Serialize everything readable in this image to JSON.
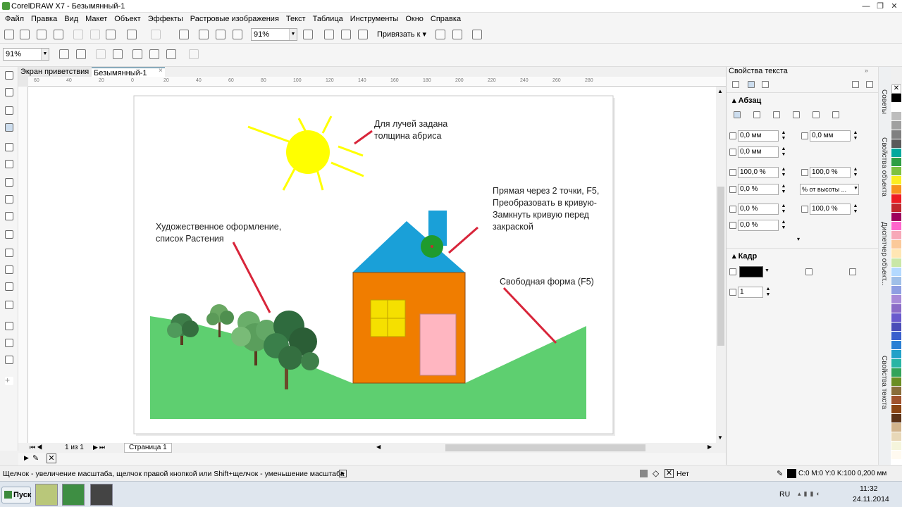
{
  "window": {
    "title": "CorelDRAW X7 - Безымянный-1"
  },
  "menu": [
    "Файл",
    "Правка",
    "Вид",
    "Макет",
    "Объект",
    "Эффекты",
    "Растровые изображения",
    "Текст",
    "Таблица",
    "Инструменты",
    "Окно",
    "Справка"
  ],
  "toolbar": {
    "zoom_value": "91%",
    "snap_label": "Привязать к"
  },
  "propbar": {
    "zoom_value": "91%"
  },
  "tabs": [
    {
      "label": "Экран приветствия"
    },
    {
      "label": "Безымянный-1"
    }
  ],
  "ruler_labels": [
    "60",
    "40",
    "20",
    "0",
    "20",
    "40",
    "60",
    "80",
    "100",
    "120",
    "140",
    "160",
    "180",
    "200",
    "220",
    "240",
    "260",
    "280"
  ],
  "canvas_notes": {
    "note1": [
      "Для лучей задана",
      "толщина абриса"
    ],
    "note2": [
      "Прямая через 2 точки, F5,",
      "Преобразовать в кривую-",
      "Замкнуть кривую перед",
      "закраской"
    ],
    "note3": [
      "Художественное оформление,",
      "список Растения"
    ],
    "note4": [
      "Свободная форма (F5)"
    ]
  },
  "pages": {
    "counter": "1 из 1",
    "page_tab": "Страница 1"
  },
  "dock": {
    "title": "Свойства текста",
    "paragraph_section": "Абзац",
    "fields": {
      "indent_left": "0,0 мм",
      "indent_first": "0,0 мм",
      "indent_right": "0,0 мм",
      "spacing_char": "100,0 %",
      "spacing_line": "100,0 %",
      "before_para": "0,0 %",
      "line_unit": "% от высоты ...",
      "lang_space": "0,0 %",
      "word_space": "100,0 %",
      "after_para": "0,0 %"
    },
    "frame_section": "Кадр",
    "columns": "1"
  },
  "side_tabs": [
    "Советы",
    "Свойства объекта",
    "Диспетчер объект...",
    "Свойства текста"
  ],
  "status": {
    "hint": "Щелчок - увеличение масштаба, щелчок правой кнопкой или Shift+щелчок - уменьшение масштаба",
    "fill_none": "Нет",
    "outline": "C:0 M:0 Y:0 K:100  0,200 мм"
  },
  "taskbar": {
    "start": "Пуск",
    "lang": "RU",
    "time": "11:32",
    "date": "24.11.2014"
  },
  "colors": {
    "sky_sun": "#ffff00",
    "roof": "#1aa0d8",
    "house": "#f07d00",
    "window": "#f5e000",
    "door": "#ffb6c1",
    "grass": "#5ecf70",
    "annotation": "#d8253a"
  },
  "palette": [
    "#000000",
    "#ffffff",
    "#bdbdbd",
    "#a0a0a0",
    "#808080",
    "#5a5a5a",
    "#00a99d",
    "#2f9e44",
    "#7fc241",
    "#fcee21",
    "#f7931e",
    "#ed1c24",
    "#c1272d",
    "#9e005d",
    "#ff66cc",
    "#f7a8b8",
    "#fbc99a",
    "#ffe6b3",
    "#c9e7a7",
    "#b3d9ff",
    "#9fbfe8",
    "#8e9ee2",
    "#a88ad8",
    "#8b6bc7",
    "#6a5acd",
    "#4b4db8",
    "#3a5fcd",
    "#2a7fd4",
    "#22a1c8",
    "#28b5a5",
    "#33a35a",
    "#6b8e23",
    "#8a6d3b",
    "#a0522d",
    "#8b4513",
    "#5c3317",
    "#d2b48c",
    "#e8d8b8",
    "#f5f5dc",
    "#fffaf0"
  ]
}
